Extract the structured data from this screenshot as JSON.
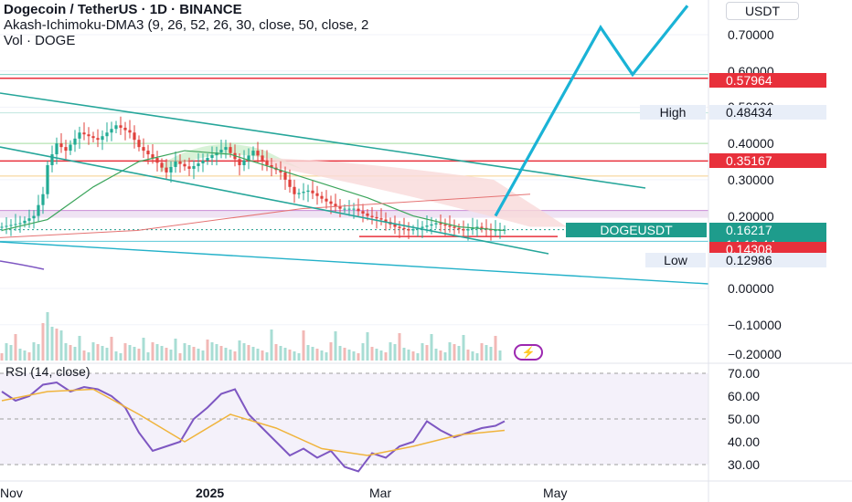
{
  "header": {
    "symbol_line": "Dogecoin / TetherUS · 1D · BINANCE",
    "indicator_line": "Akash-Ichimoku-DMA3 (9, 26, 52, 26, 30, close, 50, close, 2",
    "volume_line": "Vol · DOGE"
  },
  "currency_button": "USDT",
  "price_axis": [
    "0.70000",
    "0.60000",
    "0.50000",
    "0.40000",
    "0.30000",
    "0.20000",
    "0.00000",
    "−0.10000",
    "−0.20000"
  ],
  "rsi_axis": [
    "70.00",
    "60.00",
    "50.00",
    "40.00",
    "30.00"
  ],
  "time_axis": [
    "Nov",
    "2025",
    "Mar",
    "May"
  ],
  "rsi_title": "RSI (14, close)",
  "markers": {
    "resistance_1": "0.57964",
    "high_label": "High",
    "high_value": "0.48434",
    "resistance_2": "0.35167",
    "symbol_tag": "DOGEUSDT",
    "last_price": "0.16217",
    "countdown": "14:18:44",
    "support": "0.14308",
    "low_label": "Low",
    "low_value": "0.12986"
  },
  "colors": {
    "bull": "#22ab94",
    "bear": "#e0403b",
    "resistance_line": "#e8303b",
    "channel": "#26a69a",
    "projection": "#1ab3d6",
    "trendline": "#23b1c9",
    "rsi_line": "#7e57c2",
    "rsi_ma": "#f0b43c",
    "price_tag": "#1e9c8c"
  },
  "chart_data": {
    "type": "candlestick",
    "symbol": "DOGEUSDT",
    "timeframe": "1D",
    "exchange": "BINANCE",
    "price_range": [
      -0.2,
      0.75
    ],
    "last_price": 0.16217,
    "levels": {
      "resistance_1": 0.57964,
      "high": 0.48434,
      "resistance_2": 0.35167,
      "support": 0.14308,
      "low": 0.12986
    },
    "price_series": [
      {
        "t": 0,
        "p": 0.17
      },
      {
        "t": 4,
        "p": 0.18
      },
      {
        "t": 7,
        "p": 0.2
      },
      {
        "t": 9,
        "p": 0.26
      },
      {
        "t": 10,
        "p": 0.34
      },
      {
        "t": 12,
        "p": 0.4
      },
      {
        "t": 14,
        "p": 0.38
      },
      {
        "t": 17,
        "p": 0.43
      },
      {
        "t": 21,
        "p": 0.41
      },
      {
        "t": 25,
        "p": 0.45
      },
      {
        "t": 28,
        "p": 0.43
      },
      {
        "t": 30,
        "p": 0.39
      },
      {
        "t": 33,
        "p": 0.36
      },
      {
        "t": 36,
        "p": 0.32
      },
      {
        "t": 38,
        "p": 0.35
      },
      {
        "t": 41,
        "p": 0.33
      },
      {
        "t": 45,
        "p": 0.36
      },
      {
        "t": 49,
        "p": 0.39
      },
      {
        "t": 52,
        "p": 0.34
      },
      {
        "t": 55,
        "p": 0.38
      },
      {
        "t": 58,
        "p": 0.34
      },
      {
        "t": 61,
        "p": 0.32
      },
      {
        "t": 64,
        "p": 0.26
      },
      {
        "t": 67,
        "p": 0.27
      },
      {
        "t": 71,
        "p": 0.24
      },
      {
        "t": 74,
        "p": 0.22
      },
      {
        "t": 77,
        "p": 0.22
      },
      {
        "t": 80,
        "p": 0.2
      },
      {
        "t": 83,
        "p": 0.19
      },
      {
        "t": 86,
        "p": 0.17
      },
      {
        "t": 89,
        "p": 0.16
      },
      {
        "t": 92,
        "p": 0.17
      },
      {
        "t": 95,
        "p": 0.18
      },
      {
        "t": 98,
        "p": 0.17
      },
      {
        "t": 101,
        "p": 0.16
      },
      {
        "t": 104,
        "p": 0.17
      },
      {
        "t": 107,
        "p": 0.16
      },
      {
        "t": 110,
        "p": 0.162
      }
    ],
    "ma_series": [
      {
        "t": 0,
        "p": 0.16
      },
      {
        "t": 10,
        "p": 0.19
      },
      {
        "t": 20,
        "p": 0.28
      },
      {
        "t": 30,
        "p": 0.35
      },
      {
        "t": 40,
        "p": 0.38
      },
      {
        "t": 50,
        "p": 0.37
      },
      {
        "t": 60,
        "p": 0.33
      },
      {
        "t": 70,
        "p": 0.29
      },
      {
        "t": 80,
        "p": 0.25
      },
      {
        "t": 90,
        "p": 0.2
      },
      {
        "t": 100,
        "p": 0.17
      },
      {
        "t": 110,
        "p": 0.16
      }
    ],
    "projection_path": [
      {
        "t": 104,
        "p": 0.2
      },
      {
        "t": 127,
        "p": 0.72
      },
      {
        "t": 134,
        "p": 0.59
      },
      {
        "t": 146,
        "p": 0.78
      }
    ],
    "rsi": {
      "period": 14,
      "range": [
        25,
        75
      ],
      "series": [
        {
          "t": 0,
          "v": 62
        },
        {
          "t": 3,
          "v": 58
        },
        {
          "t": 6,
          "v": 60
        },
        {
          "t": 9,
          "v": 65
        },
        {
          "t": 12,
          "v": 66
        },
        {
          "t": 15,
          "v": 62
        },
        {
          "t": 18,
          "v": 64
        },
        {
          "t": 21,
          "v": 63
        },
        {
          "t": 24,
          "v": 60
        },
        {
          "t": 27,
          "v": 55
        },
        {
          "t": 30,
          "v": 44
        },
        {
          "t": 33,
          "v": 36
        },
        {
          "t": 36,
          "v": 38
        },
        {
          "t": 39,
          "v": 40
        },
        {
          "t": 42,
          "v": 50
        },
        {
          "t": 45,
          "v": 55
        },
        {
          "t": 48,
          "v": 61
        },
        {
          "t": 51,
          "v": 63
        },
        {
          "t": 54,
          "v": 52
        },
        {
          "t": 57,
          "v": 46
        },
        {
          "t": 60,
          "v": 40
        },
        {
          "t": 63,
          "v": 34
        },
        {
          "t": 66,
          "v": 37
        },
        {
          "t": 69,
          "v": 33
        },
        {
          "t": 72,
          "v": 36
        },
        {
          "t": 75,
          "v": 29
        },
        {
          "t": 78,
          "v": 27
        },
        {
          "t": 81,
          "v": 35
        },
        {
          "t": 84,
          "v": 33
        },
        {
          "t": 87,
          "v": 38
        },
        {
          "t": 90,
          "v": 40
        },
        {
          "t": 93,
          "v": 49
        },
        {
          "t": 96,
          "v": 45
        },
        {
          "t": 99,
          "v": 42
        },
        {
          "t": 102,
          "v": 44
        },
        {
          "t": 105,
          "v": 46
        },
        {
          "t": 108,
          "v": 47
        },
        {
          "t": 110,
          "v": 49
        }
      ],
      "ma_series": [
        {
          "t": 0,
          "v": 58
        },
        {
          "t": 10,
          "v": 62
        },
        {
          "t": 20,
          "v": 63
        },
        {
          "t": 30,
          "v": 52
        },
        {
          "t": 40,
          "v": 40
        },
        {
          "t": 50,
          "v": 52
        },
        {
          "t": 60,
          "v": 46
        },
        {
          "t": 70,
          "v": 37
        },
        {
          "t": 80,
          "v": 34
        },
        {
          "t": 90,
          "v": 38
        },
        {
          "t": 100,
          "v": 43
        },
        {
          "t": 110,
          "v": 45
        }
      ]
    }
  }
}
